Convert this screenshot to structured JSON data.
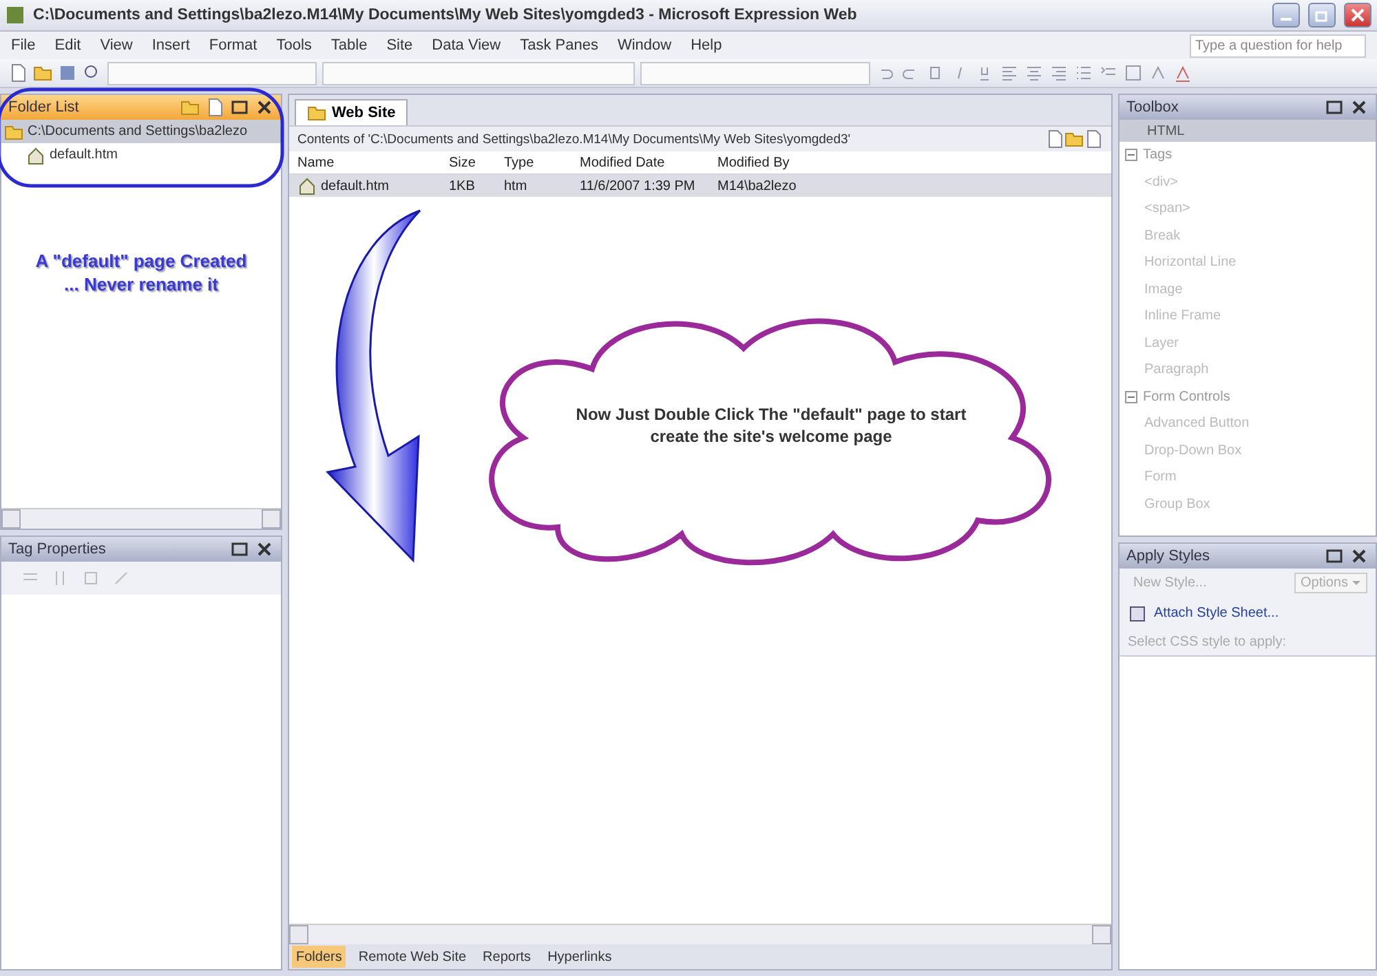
{
  "window": {
    "title": "C:\\Documents and Settings\\ba2lezo.M14\\My Documents\\My Web Sites\\yomgded3 - Microsoft Expression Web"
  },
  "menu": {
    "items": [
      "File",
      "Edit",
      "View",
      "Insert",
      "Format",
      "Tools",
      "Table",
      "Site",
      "Data View",
      "Task Panes",
      "Window",
      "Help"
    ],
    "help_placeholder": "Type a question for help"
  },
  "folder_list": {
    "title": "Folder List",
    "root": {
      "label": "C:\\Documents and Settings\\ba2lezo",
      "selected": true,
      "children": [
        {
          "label": "default.htm",
          "selected": false
        }
      ]
    }
  },
  "note": {
    "lines": [
      "A \"default\" page Created",
      "... Never rename it"
    ]
  },
  "tag_properties": {
    "title": "Tag Properties"
  },
  "editor": {
    "tabs": [
      {
        "label": "Web Site",
        "selected": true
      }
    ],
    "path": "Contents of 'C:\\Documents and Settings\\ba2lezo.M14\\My Documents\\My Web Sites\\yomgded3'",
    "columns": [
      "Name",
      "Size",
      "Type",
      "Modified Date",
      "Modified By"
    ],
    "rows": [
      {
        "cells": [
          "default.htm",
          "1KB",
          "htm",
          "11/6/2007 1:39 PM",
          "M14\\ba2lezo"
        ],
        "selected": true
      }
    ],
    "cloud_text": "Now Just Double Click The \"default\" page to start create the site's welcome page",
    "view_tabs": [
      {
        "label": "Folders",
        "selected": true
      },
      {
        "label": "Remote Web Site",
        "selected": false
      },
      {
        "label": "Reports",
        "selected": false
      },
      {
        "label": "Hyperlinks",
        "selected": false
      }
    ]
  },
  "toolbox": {
    "title": "Toolbox",
    "header": "HTML",
    "groups": [
      {
        "label": "Tags",
        "expanded": true,
        "children": [
          {
            "label": "<div>"
          },
          {
            "label": "<span>"
          },
          {
            "label": "Break"
          },
          {
            "label": "Horizontal Line"
          },
          {
            "label": "Image"
          },
          {
            "label": "Inline Frame"
          },
          {
            "label": "Layer"
          },
          {
            "label": "Paragraph"
          }
        ]
      },
      {
        "label": "Form Controls",
        "expanded": true,
        "children": [
          {
            "label": "Advanced Button"
          },
          {
            "label": "Drop-Down Box"
          },
          {
            "label": "Form"
          },
          {
            "label": "Group Box"
          }
        ]
      }
    ]
  },
  "apply_styles": {
    "title": "Apply Styles",
    "new_style": {
      "label": "New Style...",
      "disabled": true
    },
    "options": {
      "label": "Options",
      "disabled": true
    },
    "attach": "Attach Style Sheet...",
    "hint": "Select CSS style to apply:"
  }
}
